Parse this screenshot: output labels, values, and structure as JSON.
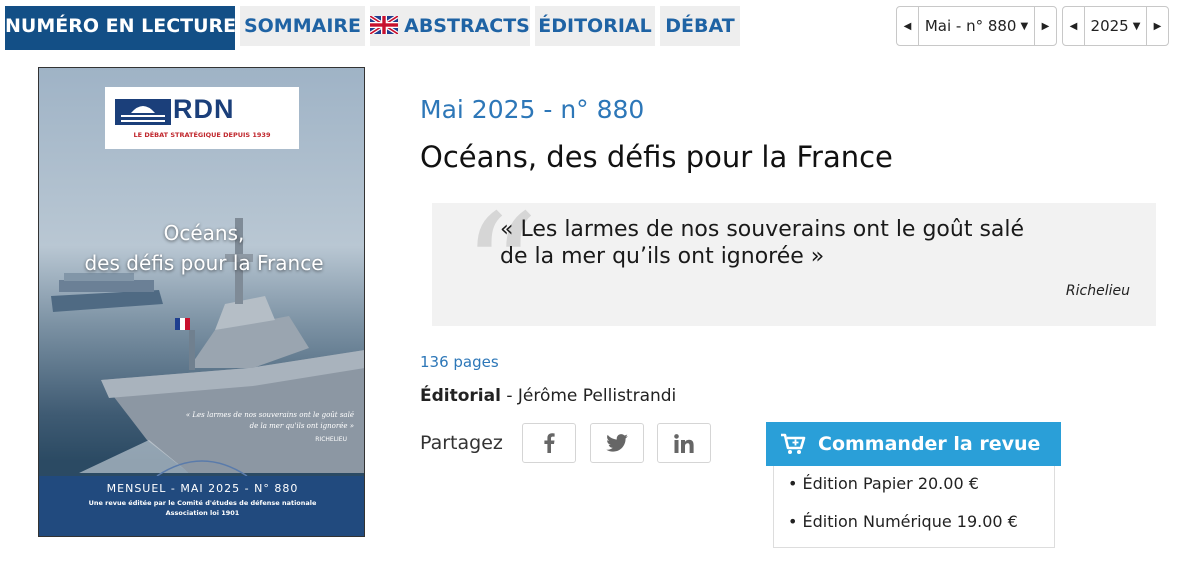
{
  "nav": {
    "tabs": [
      {
        "label": "NUMÉRO EN LECTURE",
        "active": true
      },
      {
        "label": "SOMMAIRE"
      },
      {
        "label": "ABSTRACTS",
        "icon": "uk-flag-icon"
      },
      {
        "label": "ÉDITORIAL"
      },
      {
        "label": "DÉBAT"
      }
    ],
    "issue_selector": "Mai - n° 880",
    "year_selector": "2025"
  },
  "cover": {
    "logo": "RDN",
    "logo_tagline": "LE DÉBAT STRATÉGIQUE DEPUIS 1939",
    "title_line1": "Océans,",
    "title_line2": "des défis pour la France",
    "quote_line1": "« Les larmes de nos souverains ont le goût salé",
    "quote_line2": "de la mer qu'ils ont ignorée »",
    "quote_author": "RICHELIEU",
    "issue": "MENSUEL - MAI 2025 - N° 880",
    "publisher_line1": "Une revue éditée par le Comité d'études de défense nationale",
    "publisher_line2": "Association loi 1901"
  },
  "issue": {
    "heading": "Mai 2025 - n° 880",
    "title": "Océans, des défis pour la France",
    "quote_line1": "« Les larmes de nos souverains ont le goût salé",
    "quote_line2": "de la mer qu’ils ont ignorée »",
    "quote_author": "Richelieu",
    "pages": "136 pages",
    "editorial_label": "Éditorial",
    "editorial_author": " - Jérôme Pellistrandi"
  },
  "share": {
    "label": "Partagez",
    "networks": [
      "facebook-icon",
      "twitter-icon",
      "linkedin-icon"
    ]
  },
  "order": {
    "button_label": "Commander la revue",
    "options": [
      "• Édition Papier 20.00 €",
      "• Édition Numérique 19.00 €"
    ]
  },
  "colors": {
    "nav_active": "#134f86",
    "link_blue": "#2d77b8",
    "order_button": "#2a9fd8"
  }
}
